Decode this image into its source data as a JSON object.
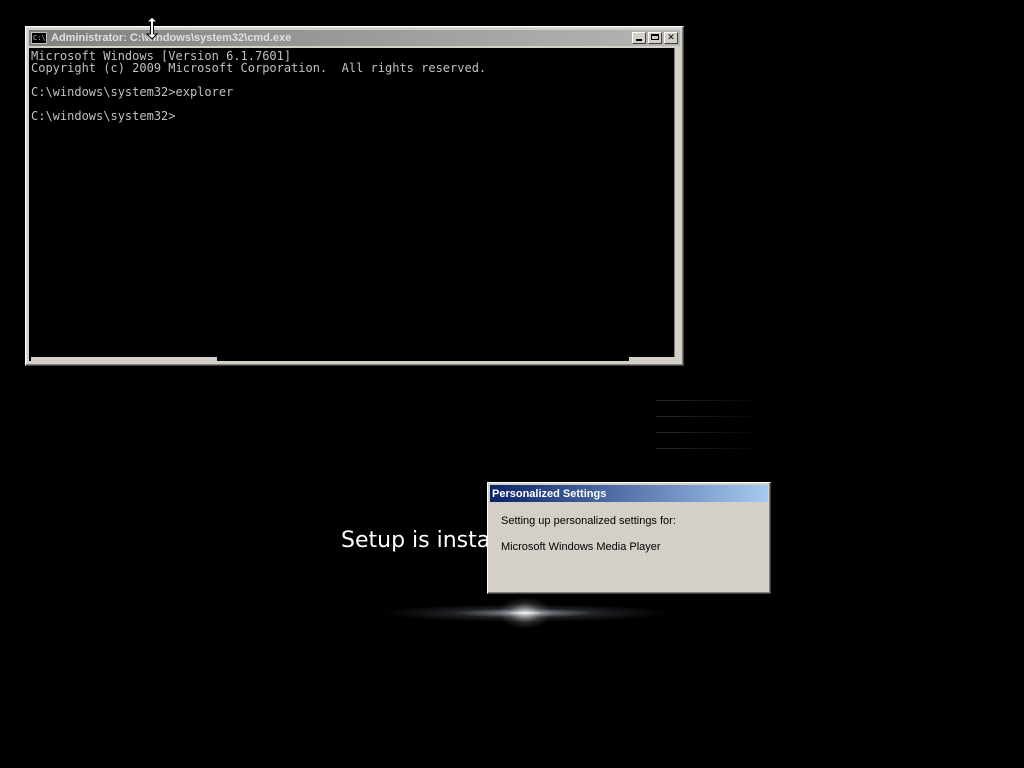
{
  "setup": {
    "status_text": "Setup is instal"
  },
  "cmd_window": {
    "title": "Administrator: C:\\windows\\system32\\cmd.exe",
    "icon": "cmd-console-icon",
    "icon_glyph": "C:\\",
    "output": "Microsoft Windows [Version 6.1.7601]\nCopyright (c) 2009 Microsoft Corporation.  All rights reserved.\n\nC:\\windows\\system32>explorer\n\nC:\\windows\\system32>",
    "controls": {
      "minimize": "minimize-icon",
      "maximize": "maximize-icon",
      "close": "close-icon",
      "close_glyph": "✕"
    }
  },
  "dialog": {
    "title": "Personalized Settings",
    "line1": "Setting up personalized settings for:",
    "line2": "Microsoft Windows Media Player"
  },
  "colors": {
    "desktop_bg": "#000000",
    "console_text": "#c0c0c0",
    "window_face": "#d4d0c8",
    "inactive_title_start": "#808080",
    "active_title_start": "#0a246a",
    "active_title_end": "#a6caf0"
  }
}
